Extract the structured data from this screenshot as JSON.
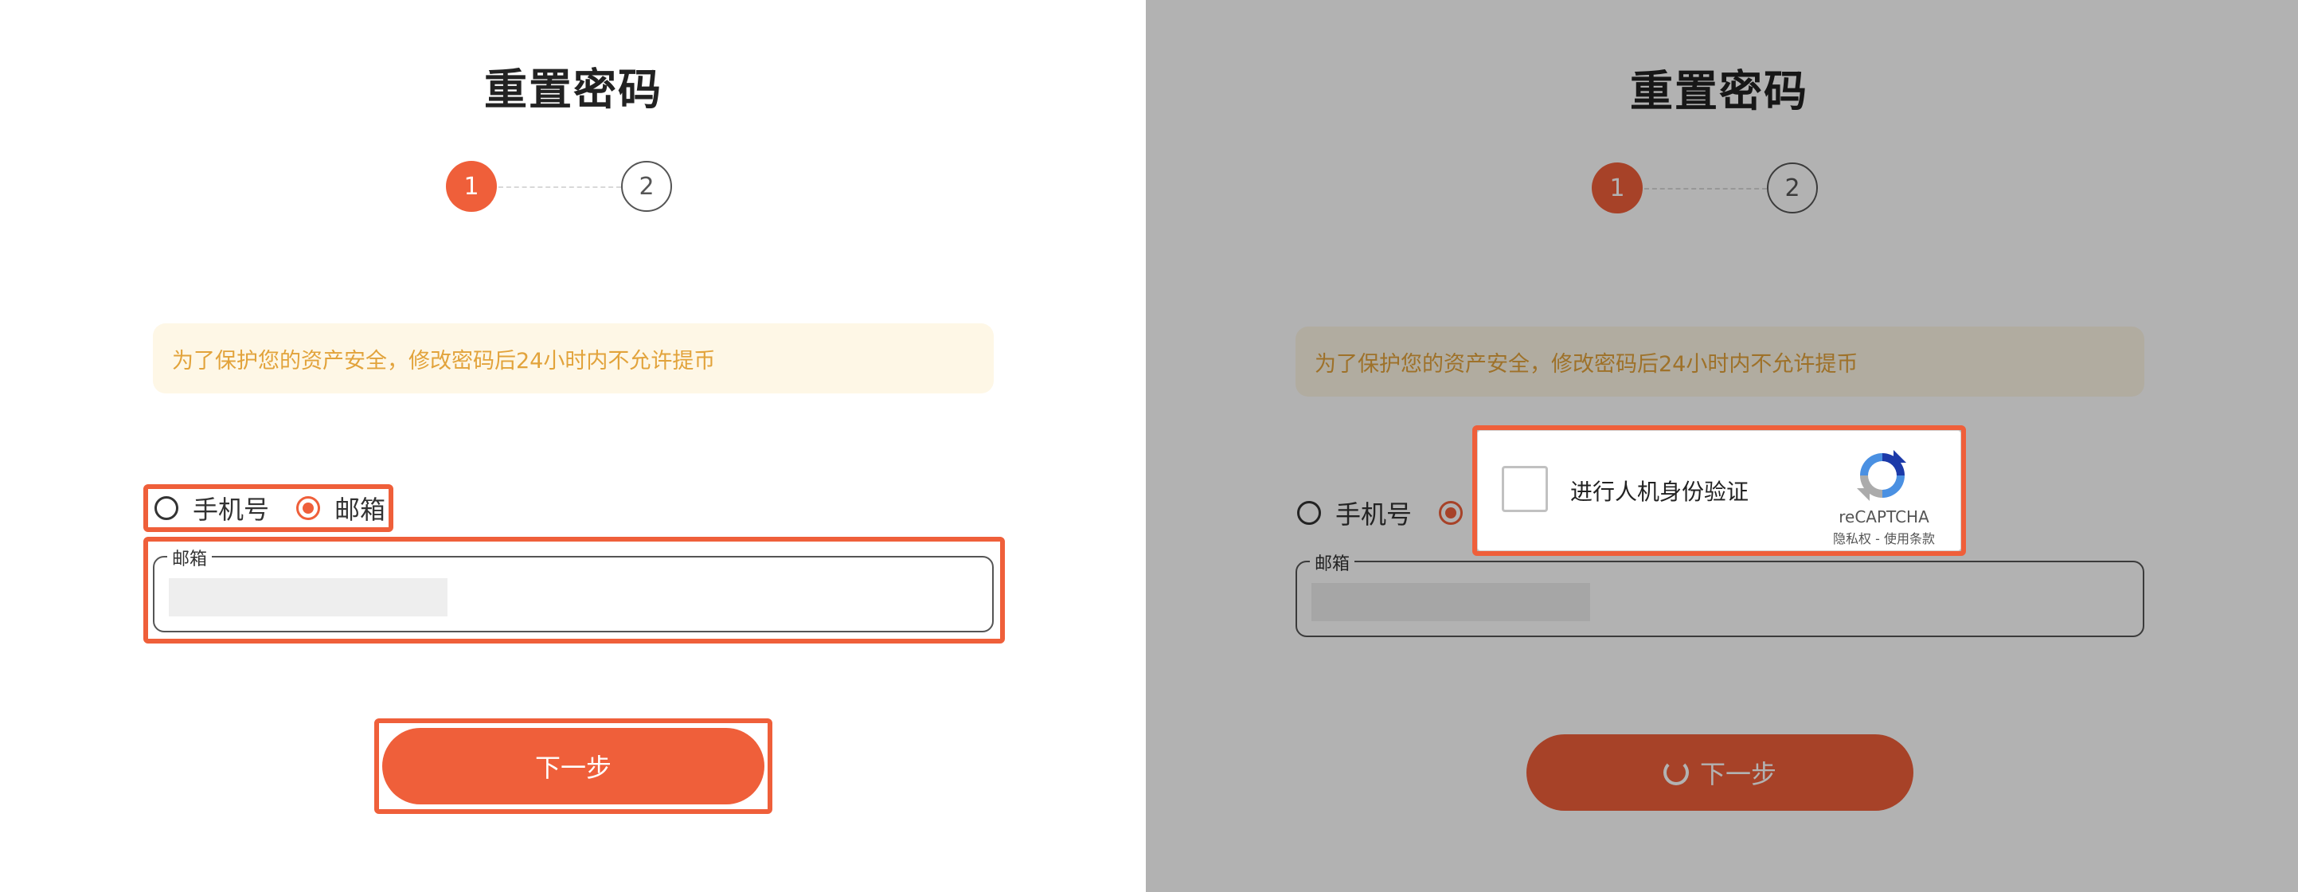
{
  "page": {
    "title": "重置密码",
    "steps": [
      "1",
      "2"
    ],
    "notice": "为了保护您的资产安全，修改密码后24小时内不允许提币",
    "method_options": [
      "手机号",
      "邮箱"
    ],
    "selected_method": "邮箱",
    "email_field": {
      "label": "邮箱",
      "value": ""
    },
    "next_button": "下一步"
  },
  "captcha": {
    "label": "进行人机身份验证",
    "brand": "reCAPTCHA",
    "terms": "隐私权 - 使用条款"
  },
  "colors": {
    "accent": "#EF5F3A",
    "notice_bg": "#FEF7E6",
    "notice_text": "#E2A33B"
  },
  "icons": [
    "recaptcha-logo-icon",
    "spinner-icon",
    "radio-icon"
  ]
}
